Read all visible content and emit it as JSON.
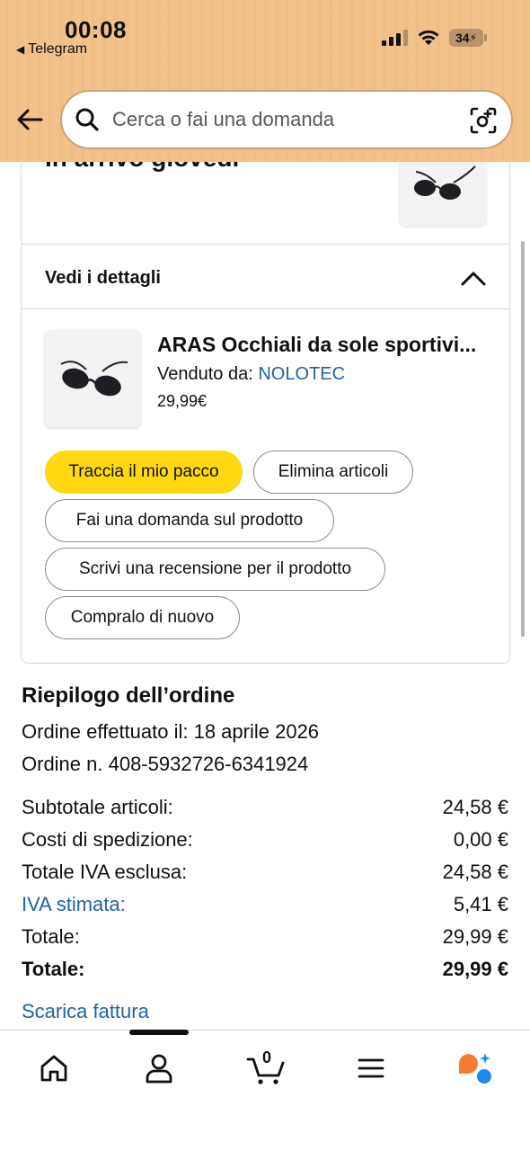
{
  "status_bar": {
    "time": "00:08",
    "back_app": "Telegram",
    "battery": "34"
  },
  "search": {
    "placeholder": "Cerca o fai una domanda"
  },
  "shipment": {
    "arrival_text": "In arrivo giovedì",
    "details_label": "Vedi i dettagli"
  },
  "product": {
    "title": "ARAS Occhiali da sole sportivi...",
    "sold_by_label": "Venduto da: ",
    "seller": "NOLOTEC",
    "price": "29,99€"
  },
  "actions": {
    "track": "Traccia il mio pacco",
    "delete": "Elimina articoli",
    "ask": "Fai una domanda sul prodotto",
    "review": "Scrivi una recensione per il prodotto",
    "buy_again": "Compralo di nuovo"
  },
  "summary": {
    "title": "Riepilogo dell’ordine",
    "order_date": "Ordine effettuato il: 18 aprile 2026",
    "order_number": "Ordine n. 408-5932726-6341924",
    "rows": [
      {
        "label": "Subtotale articoli:",
        "value": "24,58 €"
      },
      {
        "label": "Costi di spedizione:",
        "value": "0,00 €"
      },
      {
        "label": "Totale IVA esclusa:",
        "value": "24,58 €"
      },
      {
        "label": "IVA stimata:",
        "value": "5,41 €"
      },
      {
        "label": "Totale:",
        "value": "29,99 €"
      },
      {
        "label": "Totale:",
        "value": "29,99 €"
      }
    ],
    "invoice_link": "Scarica fattura"
  },
  "nav": {
    "cart_count": "0",
    "icons": [
      "home-icon",
      "account-icon",
      "cart-icon",
      "menu-icon",
      "rufus-ai-icon"
    ]
  },
  "colors": {
    "header_bg": "#f2c089",
    "primary_button": "#ffd814",
    "link": "#2162a1",
    "ai_orange": "#f47b30",
    "ai_blue": "#1a8cf0"
  }
}
